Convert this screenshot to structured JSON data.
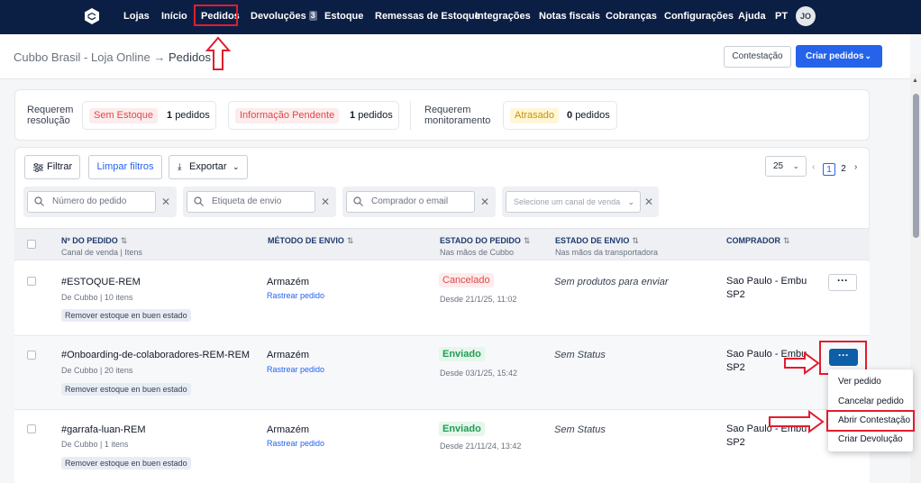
{
  "nav": {
    "logo": "cubbo-logo",
    "items": [
      {
        "label": "Lojas"
      },
      {
        "label": "Início"
      },
      {
        "label": "Pedidos"
      },
      {
        "label": "Devoluções",
        "badge": "3"
      },
      {
        "label": "Estoque"
      },
      {
        "label": "Remessas de Estoque"
      },
      {
        "label": "Integrações"
      },
      {
        "label": "Notas fiscais"
      },
      {
        "label": "Cobranças"
      },
      {
        "label": "Configurações"
      },
      {
        "label": "Ajuda"
      },
      {
        "label": "PT"
      }
    ],
    "avatar": "JO"
  },
  "header": {
    "breadcrumb_parent": "Cubbo Brasil - Loja Online",
    "breadcrumb_sep": "→",
    "breadcrumb_current": "Pedidos",
    "contest_button": "Contestação",
    "create_button": "Criar pedidos"
  },
  "status": {
    "group1_label_line1": "Requerem",
    "group1_label_line2": "resolução",
    "no_stock_tag": "Sem Estoque",
    "no_stock_count": "1",
    "pending_info_tag": "Informação Pendente",
    "pending_info_count": "1",
    "orders_word": "pedidos",
    "group2_label_line1": "Requerem",
    "group2_label_line2": "monitoramento",
    "late_tag": "Atrasado",
    "late_count": "0"
  },
  "toolbar": {
    "filter": "Filtrar",
    "clear": "Limpar filtros",
    "export": "Exportar",
    "per_page": "25",
    "pages": [
      "1",
      "2"
    ]
  },
  "filters": {
    "order_number": "Número do pedido",
    "shipping_label": "Etiqueta de envio",
    "buyer": "Comprador o email",
    "channel": "Selecione um canal de venda"
  },
  "table": {
    "columns": [
      {
        "title": "Nº DO PEDIDO",
        "sub": "Canal de venda | Itens"
      },
      {
        "title": "MÉTODO DE ENVIO",
        "sub": ""
      },
      {
        "title": "ESTADO DO PEDIDO",
        "sub": "Nas mãos de Cubbo"
      },
      {
        "title": "ESTADO DE ENVIO",
        "sub": "Nas mãos da transportadora"
      },
      {
        "title": "COMPRADOR",
        "sub": ""
      }
    ],
    "rows": [
      {
        "id": "#ESTOQUE-REM",
        "channel": "De Cubbo | 10 itens",
        "chip": "Remover estoque en buen estado",
        "method": "Armazém",
        "track": "Rastrear pedido",
        "state": "Cancelado",
        "state_date": "Desde 21/1/25, 11:02",
        "shipping": "Sem produtos para enviar",
        "buyer": "Sao Paulo - Embu SP2"
      },
      {
        "id": "#Onboarding-de-colaboradores-REM-REM",
        "channel": "De Cubbo | 20 itens",
        "chip": "Remover estoque en buen estado",
        "method": "Armazém",
        "track": "Rastrear pedido",
        "state": "Enviado",
        "state_date": "Desde 03/1/25, 15:42",
        "shipping": "Sem Status",
        "buyer": "Sao Paulo - Embu SP2"
      },
      {
        "id": "#garrafa-luan-REM",
        "channel": "De Cubbo | 1 itens",
        "chip": "Remover estoque en buen estado",
        "method": "Armazém",
        "track": "Rastrear pedido",
        "state": "Enviado",
        "state_date": "Desde 21/11/24, 13:42",
        "shipping": "Sem Status",
        "buyer": "Sao Paulo - Embu SP2"
      }
    ],
    "more": "···"
  },
  "dropdown": {
    "items": [
      "Ver pedido",
      "Cancelar pedido",
      "Abrir Contestação",
      "Criar Devolução"
    ]
  },
  "colors": {
    "nav_bg": "#0b1f44",
    "primary": "#2563eb",
    "annotation": "#e11d2e"
  }
}
